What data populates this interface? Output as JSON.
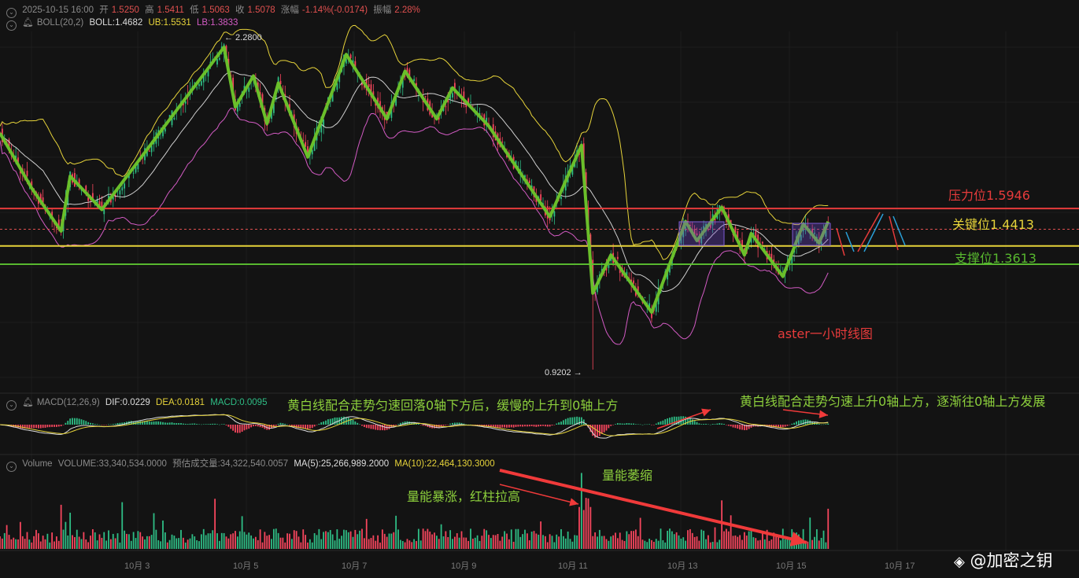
{
  "header": {
    "datetime": "2025-10-15 16:00",
    "open_label": "开",
    "open": "1.5250",
    "high_label": "高",
    "high": "1.5411",
    "low_label": "低",
    "low": "1.5063",
    "close_label": "收",
    "close": "1.5078",
    "change_label": "涨幅",
    "change": "-1.14%(-0.0174)",
    "amp_label": "振幅",
    "amp": "2.28%"
  },
  "boll": {
    "name": "BOLL(20,2)",
    "boll": "BOLL:1.4682",
    "ub": "UB:1.5531",
    "lb": "LB:1.3833"
  },
  "macd": {
    "name": "MACD(12,26,9)",
    "dif": "DIF:0.0229",
    "dea": "DEA:0.0181",
    "macd": "MACD:0.0095"
  },
  "volume": {
    "name": "Volume",
    "vol": "VOLUME:33,340,534.0000",
    "est": "预估成交量:34,322,540.0057",
    "ma5": "MA(5):25,266,989.2000",
    "ma10": "MA(10):22,464,130.3000"
  },
  "annotations": {
    "resistance": "压力位1.5946",
    "key": "关键位1.4413",
    "support": "支撑位1.3613",
    "title": "aster一小时线图",
    "macd_left": "黄白线配合走势匀速回落0轴下方后，缓慢的上升到0轴上方",
    "macd_right": "黄白线配合走势匀速上升0轴上方，逐渐往0轴上方发展",
    "vol_shrink": "量能萎缩",
    "vol_surge": "量能暴涨，红柱拉高",
    "max_label": "← 2.2800",
    "min_label": "0.9202 →"
  },
  "xaxis": [
    "10月 3",
    "10月 5",
    "10月 7",
    "10月 9",
    "10月 11",
    "10月 13",
    "10月 15",
    "10月 17"
  ],
  "watermark": "@加密之钥",
  "colors": {
    "up": "#2ebd85",
    "down": "#f6465d",
    "boll_ub": "#e6d33a",
    "boll_mid": "#cfcfcf",
    "boll_lb": "#d35bc4",
    "zigzag": "#6abf2a",
    "resistance": "#e63b3b",
    "key": "#e6d33a",
    "support": "#58b82f"
  },
  "chart_data": {
    "type": "line",
    "title": "aster一小时线图",
    "price_range": [
      0.9202,
      2.28
    ],
    "levels": {
      "resistance": 1.5946,
      "key": 1.4413,
      "support": 1.3613,
      "current": 1.5078
    },
    "zigzag_hours_price": [
      [
        0,
        1.91
      ],
      [
        14,
        1.68
      ],
      [
        27,
        1.5
      ],
      [
        31,
        1.73
      ],
      [
        45,
        1.59
      ],
      [
        99,
        2.27
      ],
      [
        104,
        2.02
      ],
      [
        112,
        2.15
      ],
      [
        118,
        1.95
      ],
      [
        123,
        2.12
      ],
      [
        136,
        1.81
      ],
      [
        153,
        2.24
      ],
      [
        171,
        1.97
      ],
      [
        179,
        2.17
      ],
      [
        193,
        1.97
      ],
      [
        200,
        2.1
      ],
      [
        216,
        1.94
      ],
      [
        243,
        1.56
      ],
      [
        257,
        1.86
      ],
      [
        262,
        1.24
      ],
      [
        270,
        1.4
      ],
      [
        288,
        1.16
      ],
      [
        303,
        1.54
      ],
      [
        308,
        1.46
      ],
      [
        319,
        1.6
      ],
      [
        329,
        1.4
      ],
      [
        332,
        1.49
      ],
      [
        346,
        1.31
      ],
      [
        355,
        1.53
      ],
      [
        362,
        1.45
      ],
      [
        366,
        1.54
      ]
    ],
    "x_ticks": [
      "10月 3",
      "10月 5",
      "10月 7",
      "10月 9",
      "10月 11",
      "10月 13",
      "10月 15",
      "10月 17"
    ]
  }
}
